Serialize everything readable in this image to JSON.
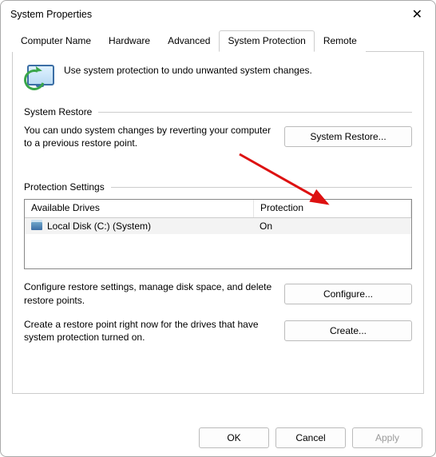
{
  "window": {
    "title": "System Properties"
  },
  "tabs": [
    {
      "label": "Computer Name"
    },
    {
      "label": "Hardware"
    },
    {
      "label": "Advanced"
    },
    {
      "label": "System Protection",
      "active": true
    },
    {
      "label": "Remote"
    }
  ],
  "intro": {
    "text": "Use system protection to undo unwanted system changes."
  },
  "restore": {
    "heading": "System Restore",
    "desc": "You can undo system changes by reverting your computer to a previous restore point.",
    "button": "System Restore..."
  },
  "protection": {
    "heading": "Protection Settings",
    "columns": {
      "drives": "Available Drives",
      "protection": "Protection"
    },
    "rows": [
      {
        "name": "Local Disk (C:) (System)",
        "protection": "On"
      }
    ],
    "configure_desc": "Configure restore settings, manage disk space, and delete restore points.",
    "configure_button": "Configure...",
    "create_desc": "Create a restore point right now for the drives that have system protection turned on.",
    "create_button": "Create..."
  },
  "footer": {
    "ok": "OK",
    "cancel": "Cancel",
    "apply": "Apply"
  }
}
